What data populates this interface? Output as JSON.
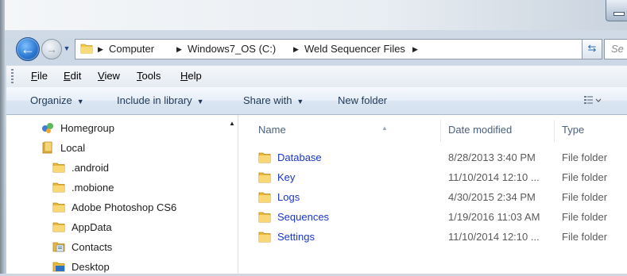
{
  "window": {
    "search_placeholder": "Se"
  },
  "address_bar": {
    "crumbs": [
      "Computer",
      "Windows7_OS (C:)",
      "Weld Sequencer Files"
    ]
  },
  "menu": {
    "items": [
      {
        "label": "File",
        "accel": "F",
        "rest": "ile"
      },
      {
        "label": "Edit",
        "accel": "E",
        "rest": "dit"
      },
      {
        "label": "View",
        "accel": "V",
        "rest": "iew"
      },
      {
        "label": "Tools",
        "accel": "T",
        "rest": "ools"
      },
      {
        "label": "Help",
        "accel": "H",
        "rest": "elp"
      }
    ]
  },
  "toolbar": {
    "organize": "Organize",
    "include_in_library": "Include in library",
    "share_with": "Share with",
    "new_folder": "New folder"
  },
  "nav_tree": [
    {
      "label": "Homegroup",
      "icon": "homegroup-icon"
    },
    {
      "label": "Local",
      "icon": "library-icon"
    },
    {
      "label": ".android",
      "icon": "folder-icon"
    },
    {
      "label": ".mobione",
      "icon": "folder-icon"
    },
    {
      "label": "Adobe Photoshop CS6",
      "icon": "folder-icon"
    },
    {
      "label": "AppData",
      "icon": "folder-icon"
    },
    {
      "label": "Contacts",
      "icon": "contacts-icon"
    },
    {
      "label": "Desktop",
      "icon": "desktop-icon"
    }
  ],
  "columns": {
    "name": "Name",
    "date_modified": "Date modified",
    "type": "Type"
  },
  "files": [
    {
      "name": "Database",
      "date": "8/28/2013 3:40 PM",
      "type": "File folder"
    },
    {
      "name": "Key",
      "date": "11/10/2014 12:10 ...",
      "type": "File folder"
    },
    {
      "name": "Logs",
      "date": "4/30/2015 2:34 PM",
      "type": "File folder"
    },
    {
      "name": "Sequences",
      "date": "1/19/2016 11:03 AM",
      "type": "File folder"
    },
    {
      "name": "Settings",
      "date": "11/10/2014 12:10 ...",
      "type": "File folder"
    }
  ],
  "colors": {
    "link_blue": "#1a36c8",
    "folder_yellow": "#f2c94c",
    "toolbar_text": "#1e3957"
  }
}
